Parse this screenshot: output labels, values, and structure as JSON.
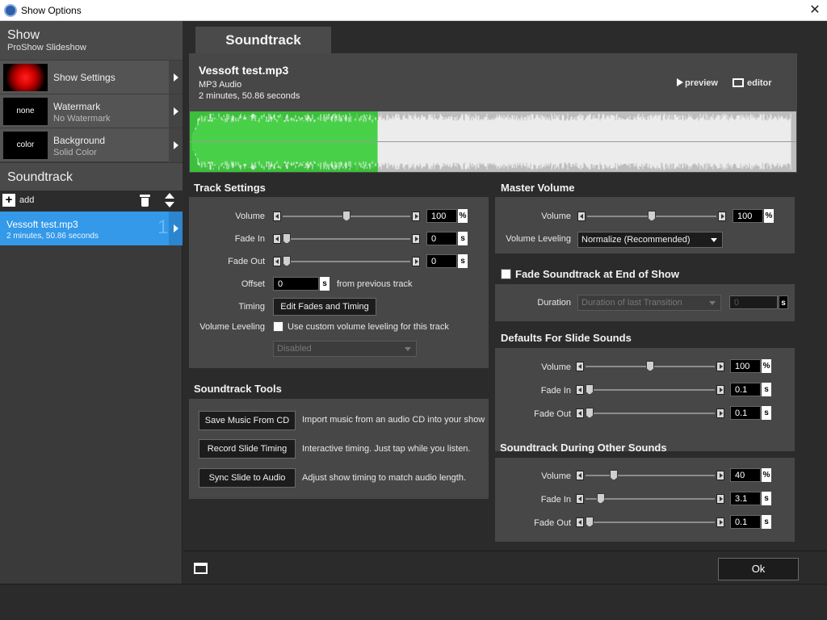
{
  "window": {
    "title": "Show Options",
    "close_glyph": "✕"
  },
  "colors": {
    "accent": "#3399e8",
    "wave_played": "#3cc23c",
    "wave_rest": "#f2f2f2"
  },
  "sidebar": {
    "show_title": "Show",
    "show_subtitle": "ProShow Slideshow",
    "items": [
      {
        "label": "Show Settings",
        "sub": ""
      },
      {
        "label": "Watermark",
        "sub": "No Watermark",
        "thumb": "none"
      },
      {
        "label": "Background",
        "sub": "Solid Color",
        "thumb": "color"
      }
    ],
    "soundtrack_title": "Soundtrack",
    "add_label": "add",
    "track": {
      "name": "Vessoft test.mp3",
      "duration": "2 minutes, 50.86 seconds",
      "number": "1"
    }
  },
  "main": {
    "tab_label": "Soundtrack",
    "file": {
      "name": "Vessoft test.mp3",
      "type": "MP3 Audio",
      "duration": "2 minutes, 50.86 seconds",
      "preview_label": "preview",
      "editor_label": "editor",
      "played_fraction": 0.31
    },
    "track_settings": {
      "title": "Track Settings",
      "volume": {
        "label": "Volume",
        "value": "100",
        "unit": "%",
        "level": 0.5
      },
      "fade_in": {
        "label": "Fade In",
        "value": "0",
        "unit": "s",
        "level": 0.0
      },
      "fade_out": {
        "label": "Fade Out",
        "value": "0",
        "unit": "s",
        "level": 0.0
      },
      "offset": {
        "label": "Offset",
        "value": "0",
        "unit": "s",
        "suffix": "from previous track"
      },
      "timing": {
        "label": "Timing",
        "button": "Edit Fades and Timing"
      },
      "leveling": {
        "label": "Volume Leveling",
        "checkbox_label": "Use custom volume leveling for this track",
        "select": "Disabled"
      }
    },
    "tools": {
      "title": "Soundtrack Tools",
      "rows": [
        {
          "button": "Save Music From CD",
          "desc": "Import music from an audio CD into your show"
        },
        {
          "button": "Record Slide Timing",
          "desc": "Interactive timing. Just tap while you listen."
        },
        {
          "button": "Sync Slide to Audio",
          "desc": "Adjust show timing to match audio length."
        }
      ]
    },
    "master": {
      "title": "Master Volume",
      "volume": {
        "label": "Volume",
        "value": "100",
        "unit": "%",
        "level": 0.5
      },
      "leveling": {
        "label": "Volume Leveling",
        "select": "Normalize (Recommended)"
      }
    },
    "fade_end": {
      "title": "Fade Soundtrack at End of Show",
      "duration": {
        "label": "Duration",
        "select": "Duration of last Transition",
        "value": "0",
        "unit": "s"
      }
    },
    "defaults": {
      "title": "Defaults For Slide Sounds",
      "volume": {
        "label": "Volume",
        "value": "100",
        "unit": "%",
        "level": 0.5
      },
      "fade_in": {
        "label": "Fade In",
        "value": "0.1",
        "unit": "s",
        "level": 0.0
      },
      "fade_out": {
        "label": "Fade Out",
        "value": "0.1",
        "unit": "s",
        "level": 0.0
      }
    },
    "other": {
      "title": "Soundtrack During Other Sounds",
      "volume": {
        "label": "Volume",
        "value": "40",
        "unit": "%",
        "level": 0.2
      },
      "fade_in": {
        "label": "Fade In",
        "value": "3.1",
        "unit": "s",
        "level": 0.09
      },
      "fade_out": {
        "label": "Fade Out",
        "value": "0.1",
        "unit": "s",
        "level": 0.0
      }
    }
  },
  "footer": {
    "ok_label": "Ok"
  }
}
